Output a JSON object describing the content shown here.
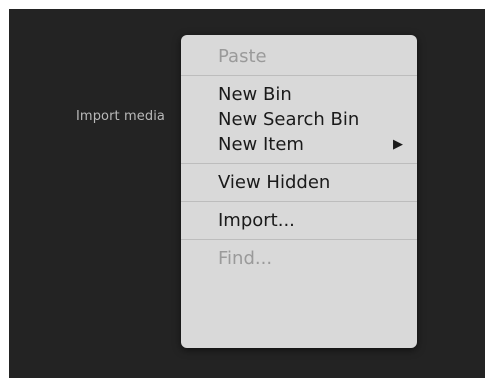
{
  "panel": {
    "placeholder": "Import media"
  },
  "context_menu": {
    "items": [
      {
        "label": "Paste",
        "enabled": false
      },
      {
        "label": "New Bin",
        "enabled": true
      },
      {
        "label": "New Search Bin",
        "enabled": true
      },
      {
        "label": "New Item",
        "enabled": true,
        "submenu_icon": "triangle-right-icon"
      },
      {
        "label": "View Hidden",
        "enabled": true
      },
      {
        "label": "Import...",
        "enabled": true
      },
      {
        "label": "Find...",
        "enabled": false
      }
    ]
  },
  "colors": {
    "panel_bg": "#232323",
    "menu_bg": "#d9d9d9",
    "disabled_text": "#9a9a9a",
    "enabled_text": "#1a1a1a"
  }
}
